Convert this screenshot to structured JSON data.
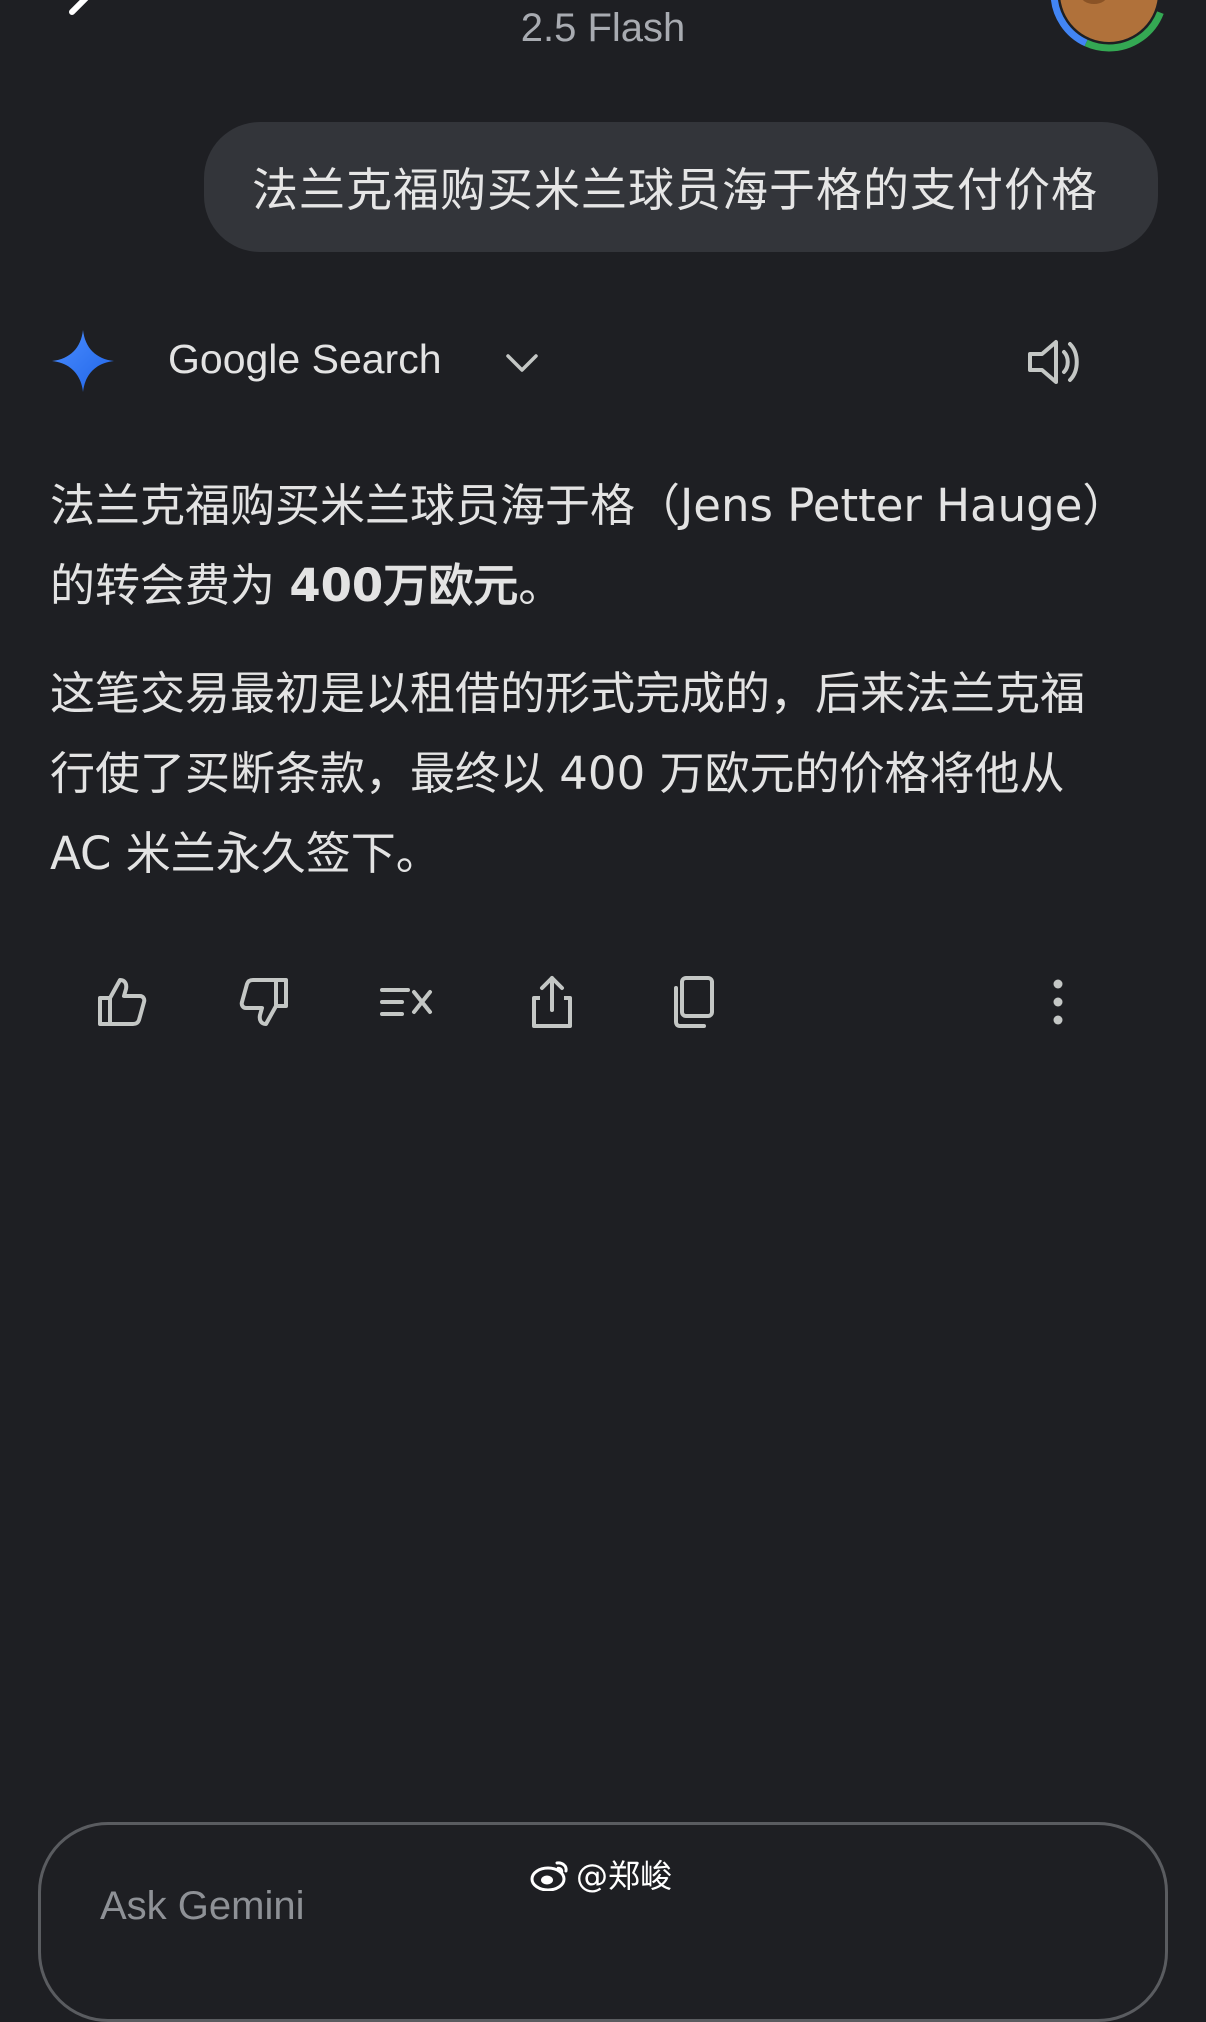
{
  "header": {
    "model_name": "2.5 Flash"
  },
  "conversation": {
    "user_message": "法兰克福购买米兰球员海于格的支付价格",
    "response_source": "Google Search",
    "response_paragraphs": {
      "p1_line1": "法兰克福购买米兰球员海于格（Jens Petter Hauge）",
      "p1_line2_prefix": "的转会费为 ",
      "p1_line2_bold": "400万欧元",
      "p1_line2_suffix": "。",
      "p2_line1": "这笔交易最初是以租借的形式完成的，后来法兰克福",
      "p2_line2": "行使了买断条款，最终以 400 万欧元的价格将他从",
      "p2_line3": "AC 米兰永久签下。"
    }
  },
  "actions": {
    "icons": [
      "thumbs-up-icon",
      "thumbs-down-icon",
      "modify-response-icon",
      "share-icon",
      "copy-icon",
      "more-options-icon"
    ]
  },
  "input": {
    "placeholder": "Ask Gemini"
  },
  "watermark": {
    "text": "@郑峻"
  },
  "colors": {
    "background": "#1e1f23",
    "bubble": "#33353a",
    "text": "#e3e3e3",
    "gemini_blue": "#4285f4"
  }
}
